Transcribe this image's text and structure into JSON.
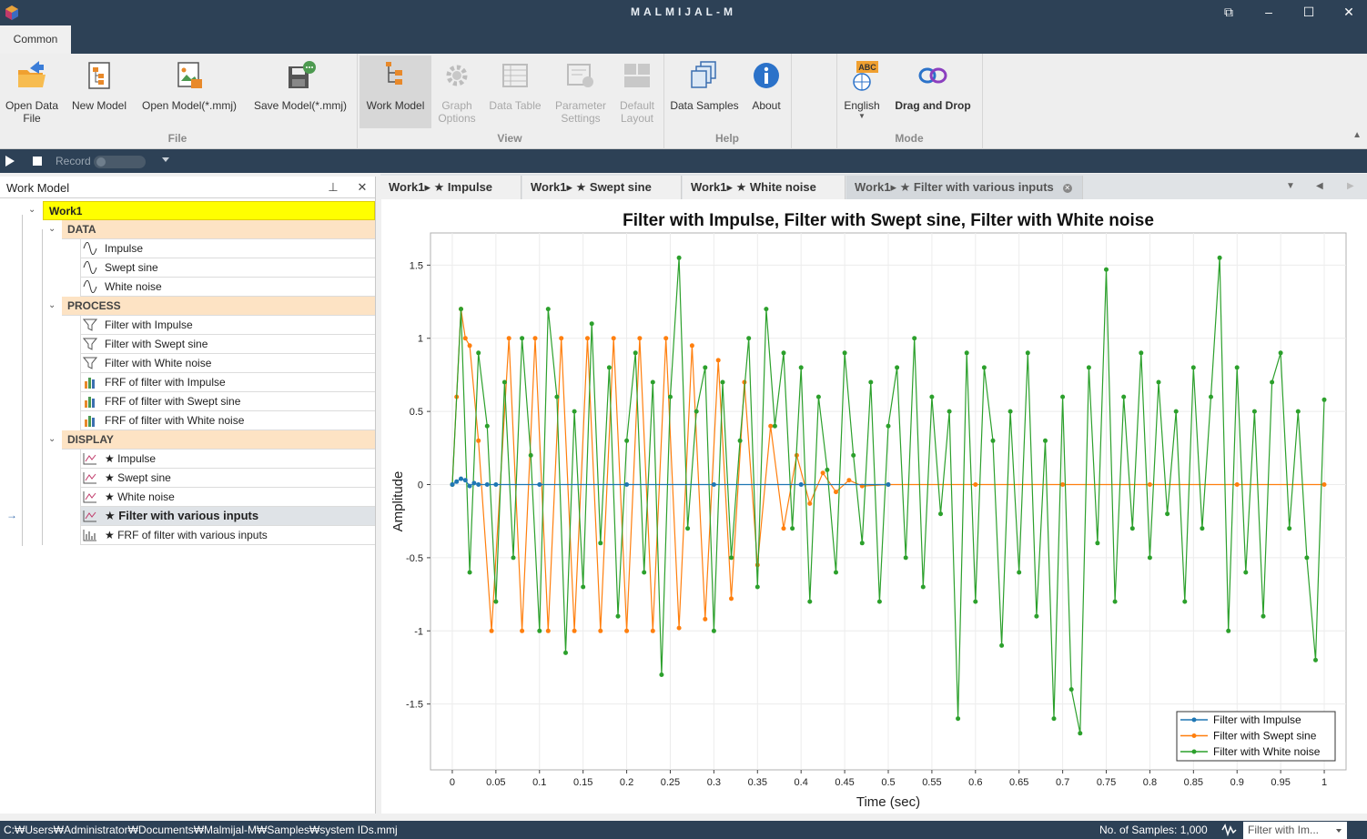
{
  "window": {
    "title": "MALMIJAL-M",
    "controls": [
      "⧉",
      "–",
      "☐",
      "✕"
    ]
  },
  "ribbon": {
    "tab": "Common",
    "buttons": [
      {
        "label": "Open Data\nFile",
        "icon": "open-folder-icon"
      },
      {
        "label": "New Model",
        "icon": "new-model-icon"
      },
      {
        "label": "Open Model(*.mmj)",
        "icon": "open-model-icon"
      },
      {
        "label": "Save Model(*.mmj)",
        "icon": "save-model-icon"
      },
      {
        "label": "Work Model",
        "icon": "work-model-icon"
      },
      {
        "label": "Graph\nOptions",
        "icon": "gear-icon"
      },
      {
        "label": "Data Table",
        "icon": "table-icon"
      },
      {
        "label": "Parameter\nSettings",
        "icon": "parameter-settings-icon"
      },
      {
        "label": "Default\nLayout",
        "icon": "layout-icon"
      },
      {
        "label": "Data Samples",
        "icon": "data-samples-icon"
      },
      {
        "label": "About",
        "icon": "info-icon"
      },
      {
        "label": "English",
        "icon": "language-icon"
      },
      {
        "label": "Drag and Drop",
        "icon": "drag-drop-icon"
      }
    ],
    "groups": [
      "File",
      "View",
      "Help",
      "Mode"
    ]
  },
  "recordbar": {
    "record_label": "Record"
  },
  "workmodel": {
    "title": "Work Model",
    "root": "Work1",
    "sections": [
      {
        "label": "DATA",
        "items": [
          "Impulse",
          "Swept sine",
          "White noise"
        ]
      },
      {
        "label": "PROCESS",
        "items": [
          "Filter with Impulse",
          "Filter with Swept sine",
          "Filter with White noise",
          "FRF of filter with Impulse",
          "FRF of filter with Swept sine",
          "FRF of filter with White noise"
        ]
      },
      {
        "label": "DISPLAY",
        "items": [
          "★ Impulse",
          "★ Swept sine",
          "★ White noise",
          "★ Filter with various inputs",
          "★ FRF of filter with various inputs"
        ]
      }
    ]
  },
  "doctabs": [
    "Work1▸ ★ Impulse",
    "Work1▸ ★ Swept sine",
    "Work1▸ ★ White noise",
    "Work1▸ ★ Filter with various inputs"
  ],
  "chart_data": {
    "type": "line",
    "title": "Filter with Impulse, Filter with Swept sine, Filter with White noise",
    "xlabel": "Time (sec)",
    "ylabel": "Amplitude",
    "xlim": [
      -0.025,
      1.025
    ],
    "ylim": [
      -1.95,
      1.72
    ],
    "xticks": [
      0,
      0.05,
      0.1,
      0.15,
      0.2,
      0.25,
      0.3,
      0.35,
      0.4,
      0.45,
      0.5,
      0.55,
      0.6,
      0.65,
      0.7,
      0.75,
      0.8,
      0.85,
      0.9,
      0.95,
      1
    ],
    "xtick_labels": [
      "0",
      "0.05",
      "0.1",
      "0.15",
      "0.2",
      "0.25",
      "0.3",
      "0.35",
      "0.4",
      "0.45",
      "0.5",
      "0.55",
      "0.6",
      "0.65",
      "0.7",
      "0.75",
      "0.8",
      "0.85",
      "0.9",
      "0.95",
      "1"
    ],
    "yticks": [
      -1.5,
      -1,
      -0.5,
      0,
      0.5,
      1,
      1.5
    ],
    "ytick_labels": [
      "-1.5",
      "-1",
      "-0.5",
      "0",
      "0.5",
      "1",
      "1.5"
    ],
    "grid": true,
    "legend_position": "bottom-right",
    "series": [
      {
        "name": "Filter with Impulse",
        "color": "#1f77b4",
        "x": [
          0,
          0.005,
          0.01,
          0.015,
          0.02,
          0.025,
          0.03,
          0.04,
          0.05,
          0.1,
          0.2,
          0.3,
          0.4,
          0.5
        ],
        "y": [
          0,
          0.02,
          0.04,
          0.03,
          -0.01,
          0.01,
          0,
          0,
          0,
          0,
          0,
          0,
          0,
          0
        ]
      },
      {
        "name": "Filter with Swept sine",
        "color": "#ff7f0e",
        "x": [
          0,
          0.005,
          0.01,
          0.015,
          0.02,
          0.03,
          0.045,
          0.065,
          0.08,
          0.095,
          0.11,
          0.125,
          0.14,
          0.155,
          0.17,
          0.185,
          0.2,
          0.215,
          0.23,
          0.245,
          0.26,
          0.275,
          0.29,
          0.305,
          0.32,
          0.335,
          0.35,
          0.365,
          0.38,
          0.395,
          0.41,
          0.425,
          0.44,
          0.455,
          0.47,
          0.5,
          0.6,
          0.7,
          0.8,
          0.9,
          1
        ],
        "y": [
          0,
          0.6,
          1.2,
          1.0,
          0.95,
          0.3,
          -1.0,
          1.0,
          -1.0,
          1.0,
          -1.0,
          1.0,
          -1.0,
          1.0,
          -1.0,
          1.0,
          -1.0,
          1.0,
          -1.0,
          1.0,
          -0.98,
          0.95,
          -0.92,
          0.85,
          -0.78,
          0.7,
          -0.55,
          0.4,
          -0.3,
          0.2,
          -0.13,
          0.08,
          -0.05,
          0.03,
          -0.01,
          0,
          0,
          0,
          0,
          0,
          0
        ]
      },
      {
        "name": "Filter with White noise",
        "color": "#2ca02c",
        "x": [
          0,
          0.01,
          0.02,
          0.03,
          0.04,
          0.05,
          0.06,
          0.07,
          0.08,
          0.09,
          0.1,
          0.11,
          0.12,
          0.13,
          0.14,
          0.15,
          0.16,
          0.17,
          0.18,
          0.19,
          0.2,
          0.21,
          0.22,
          0.23,
          0.24,
          0.25,
          0.26,
          0.27,
          0.28,
          0.29,
          0.3,
          0.31,
          0.32,
          0.33,
          0.34,
          0.35,
          0.36,
          0.37,
          0.38,
          0.39,
          0.4,
          0.41,
          0.42,
          0.43,
          0.44,
          0.45,
          0.46,
          0.47,
          0.48,
          0.49,
          0.5,
          0.51,
          0.52,
          0.53,
          0.54,
          0.55,
          0.56,
          0.57,
          0.58,
          0.59,
          0.6,
          0.61,
          0.62,
          0.63,
          0.64,
          0.65,
          0.66,
          0.67,
          0.68,
          0.69,
          0.7,
          0.71,
          0.72,
          0.73,
          0.74,
          0.75,
          0.76,
          0.77,
          0.78,
          0.79,
          0.8,
          0.81,
          0.82,
          0.83,
          0.84,
          0.85,
          0.86,
          0.87,
          0.88,
          0.89,
          0.9,
          0.91,
          0.92,
          0.93,
          0.94,
          0.95,
          0.96,
          0.97,
          0.98,
          0.99,
          1
        ],
        "y": [
          0,
          1.2,
          -0.6,
          0.9,
          0.4,
          -0.8,
          0.7,
          -0.5,
          1.0,
          0.2,
          -1.0,
          1.2,
          0.6,
          -1.15,
          0.5,
          -0.7,
          1.1,
          -0.4,
          0.8,
          -0.9,
          0.3,
          0.9,
          -0.6,
          0.7,
          -1.3,
          0.6,
          1.55,
          -0.3,
          0.5,
          0.8,
          -1.0,
          0.7,
          -0.5,
          0.3,
          1.0,
          -0.7,
          1.2,
          0.4,
          0.9,
          -0.3,
          0.8,
          -0.8,
          0.6,
          0.1,
          -0.6,
          0.9,
          0.2,
          -0.4,
          0.7,
          -0.8,
          0.4,
          0.8,
          -0.5,
          1.0,
          -0.7,
          0.6,
          -0.2,
          0.5,
          -1.6,
          0.9,
          -0.8,
          0.8,
          0.3,
          -1.1,
          0.5,
          -0.6,
          0.9,
          -0.9,
          0.3,
          -1.6,
          0.6,
          -1.4,
          -1.7,
          0.8,
          -0.4,
          1.47,
          -0.8,
          0.6,
          -0.3,
          0.9,
          -0.5,
          0.7,
          -0.2,
          0.5,
          -0.8,
          0.8,
          -0.3,
          0.6,
          1.55,
          -1.0,
          0.8,
          -0.6,
          0.5,
          -0.9,
          0.7,
          0.9,
          -0.3,
          0.5,
          -0.5,
          -1.2,
          0.58
        ]
      }
    ]
  },
  "statusbar": {
    "path": "C:₩Users₩Administrator₩Documents₩Malmijal-M₩Samples₩system IDs.mmj",
    "samples": "No. of Samples: 1,000",
    "selector": "Filter with Im..."
  }
}
